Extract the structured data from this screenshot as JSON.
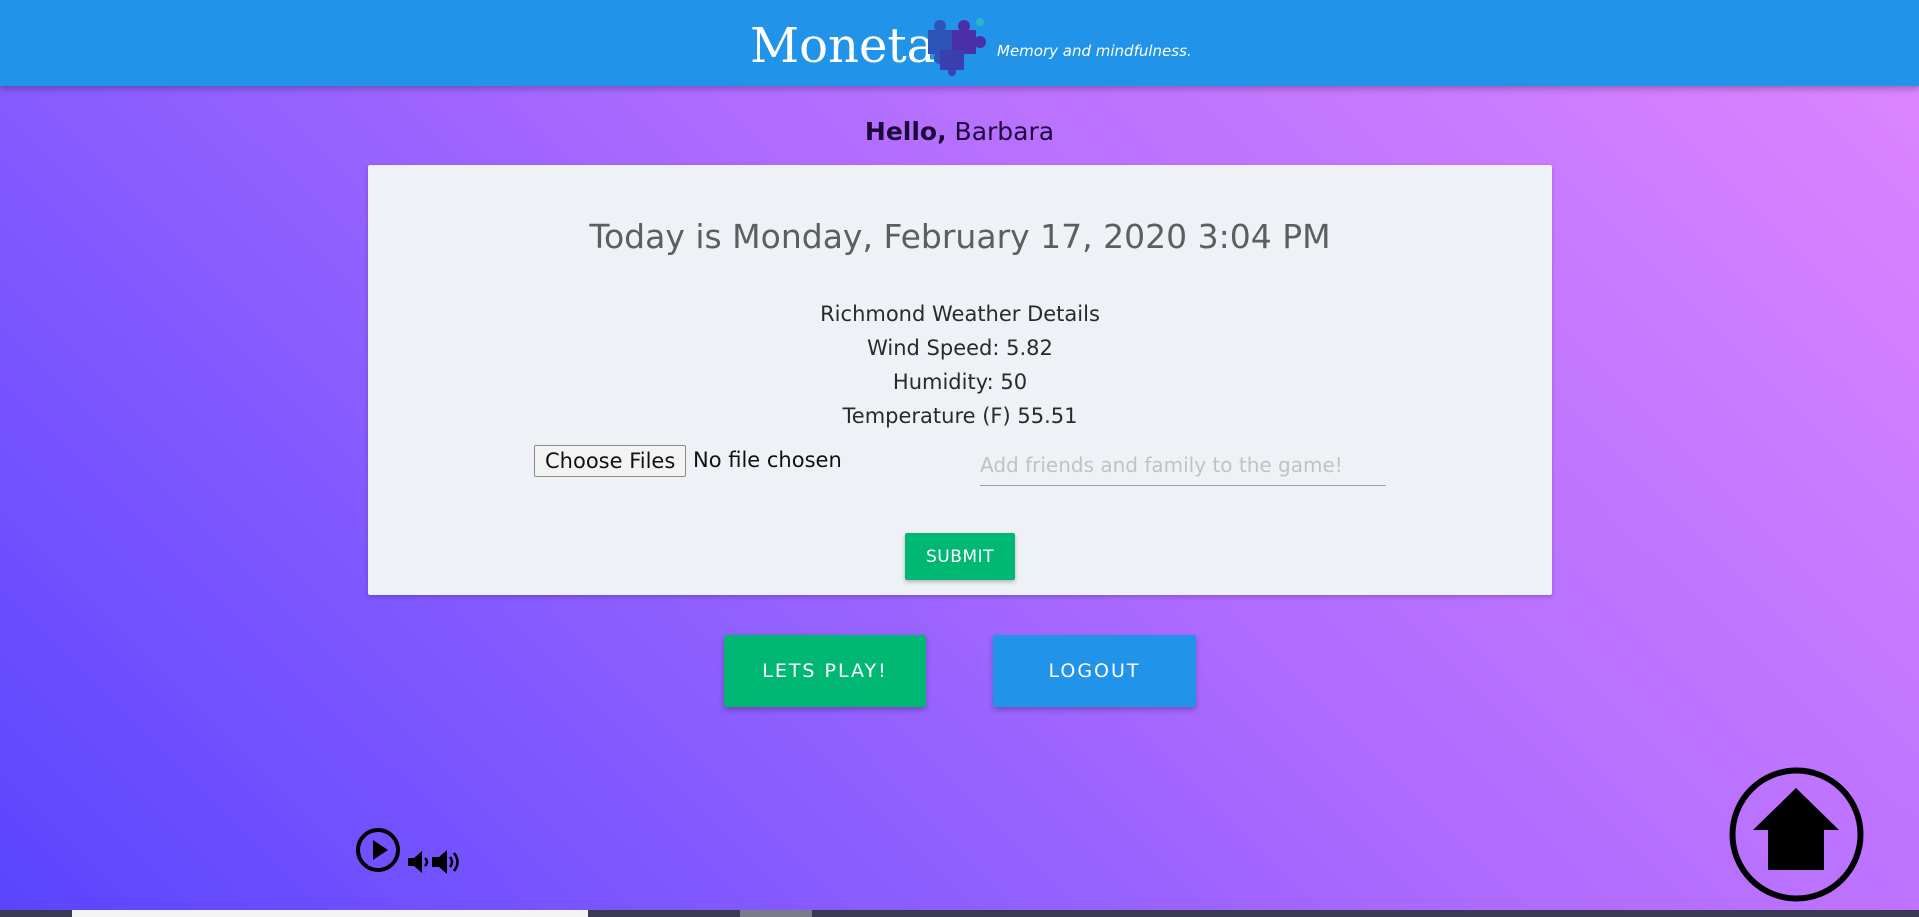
{
  "header": {
    "brand": "Moneta",
    "tagline": "Memory and mindfulness.",
    "logo_icon": "puzzle-pieces-icon",
    "colors": {
      "bar": "#2193e9"
    }
  },
  "greeting": {
    "hello": "Hello,",
    "name": "Barbara"
  },
  "card": {
    "date_line": "Today is Monday, February 17, 2020 3:04 PM",
    "weather": {
      "title": "Richmond Weather Details",
      "wind": "Wind Speed: 5.82",
      "humidity": "Humidity: 50",
      "temperature": "Temperature (F) 55.51"
    },
    "file_button": "Choose Files",
    "file_status": "No file chosen",
    "friends_placeholder": "Add friends and family to the game!",
    "friends_value": "",
    "submit_label": "SUBMIT"
  },
  "actions": {
    "play_label": "LETS PLAY!",
    "logout_label": "LOGOUT"
  },
  "icons": {
    "play": "play-circle-icon",
    "volume_down": "volume-down-icon",
    "volume_up": "volume-up-icon",
    "home": "home-icon"
  },
  "colors": {
    "green": "#00b874",
    "blue": "#2193e9",
    "card": "#eef1f5"
  }
}
